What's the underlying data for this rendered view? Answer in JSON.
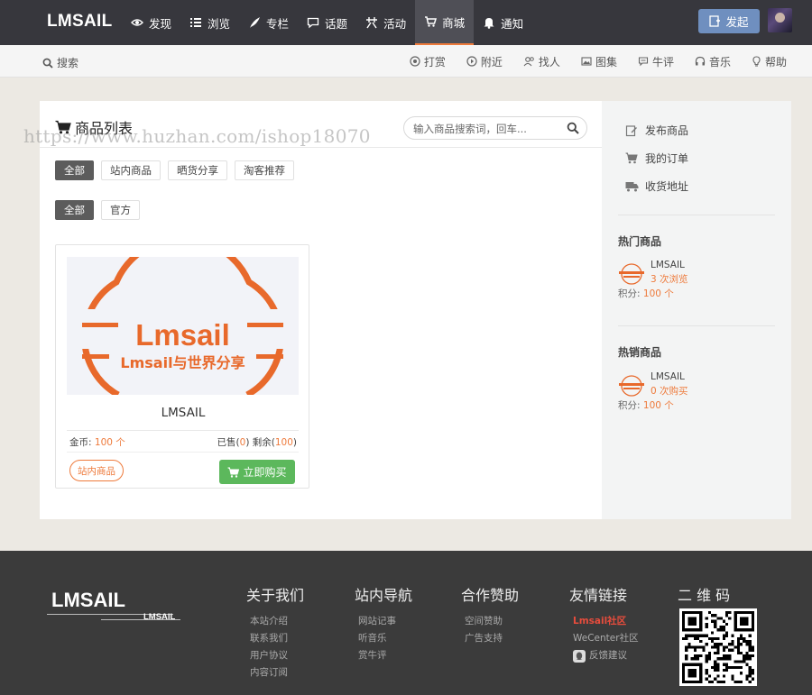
{
  "header": {
    "logo": "LMSAIL",
    "nav": [
      {
        "label": "发现",
        "icon": "eye-icon"
      },
      {
        "label": "浏览",
        "icon": "list-icon"
      },
      {
        "label": "专栏",
        "icon": "feather-icon"
      },
      {
        "label": "话题",
        "icon": "chat-icon"
      },
      {
        "label": "活动",
        "icon": "activity-icon"
      },
      {
        "label": "商城",
        "icon": "cart-icon",
        "active": true
      },
      {
        "label": "通知",
        "icon": "bell-icon"
      }
    ],
    "publish_label": "发起"
  },
  "subnav": {
    "search_label": "搜索",
    "items": [
      {
        "label": "打赏",
        "icon": "reward-icon"
      },
      {
        "label": "附近",
        "icon": "location-icon"
      },
      {
        "label": "找人",
        "icon": "people-icon"
      },
      {
        "label": "图集",
        "icon": "image-icon"
      },
      {
        "label": "牛评",
        "icon": "comment-icon"
      },
      {
        "label": "音乐",
        "icon": "headphones-icon"
      },
      {
        "label": "帮助",
        "icon": "lightbulb-icon"
      }
    ]
  },
  "list": {
    "title": "商品列表",
    "search_placeholder": "输入商品搜索词，回车..."
  },
  "filters": {
    "row1": [
      "全部",
      "站内商品",
      "晒货分享",
      "淘客推荐"
    ],
    "row2": [
      "全部",
      "官方"
    ]
  },
  "product": {
    "image_text_main": "Lmsail",
    "image_text_sub": "Lmsail与世界分享",
    "name": "LMSAIL",
    "coin_label": "金币:",
    "coin_value": "100 个",
    "sold_label": "已售(",
    "sold_value": "0",
    "remain_label": ") 剩余(",
    "remain_value": "100",
    "close_paren": ")",
    "tag": "站内商品",
    "buy_label": "立即购买"
  },
  "right_panel": {
    "links": [
      {
        "label": "发布商品",
        "icon": "edit-icon"
      },
      {
        "label": "我的订单",
        "icon": "cart-icon"
      },
      {
        "label": "收货地址",
        "icon": "truck-icon"
      }
    ],
    "hot": {
      "heading": "热门商品",
      "name": "LMSAIL",
      "stat_num": "3",
      "stat_text": " 次浏览",
      "points_label": "积分:",
      "points_value": "100 个"
    },
    "best": {
      "heading": "热销商品",
      "name": "LMSAIL",
      "stat_num": "0",
      "stat_text": " 次购买",
      "points_label": "积分:",
      "points_value": "100 个"
    }
  },
  "watermark": "https://www.huzhan.com/ishop18070",
  "footer": {
    "logo": "LMSAIL",
    "logo_small": "LMSAIL",
    "columns": [
      {
        "title": "关于我们",
        "links": [
          "本站介绍",
          "联系我们",
          "用户协议",
          "内容订阅"
        ]
      },
      {
        "title": "站内导航",
        "links": [
          "网站记事",
          "听音乐",
          "赏牛评"
        ]
      },
      {
        "title": "合作赞助",
        "links": [
          "空间赞助",
          "广告支持"
        ]
      },
      {
        "title": "友情链接",
        "links": [
          "Lmsail社区",
          "WeCenter社区",
          "反馈建议"
        ]
      },
      {
        "title": "二 维 码"
      }
    ]
  },
  "colors": {
    "accent": "#ee7a3b",
    "nav_bg": "#37373d",
    "buy_green": "#5cb85c",
    "publish_blue": "#6f8fbf",
    "footer_bg": "#3b3b3b"
  }
}
